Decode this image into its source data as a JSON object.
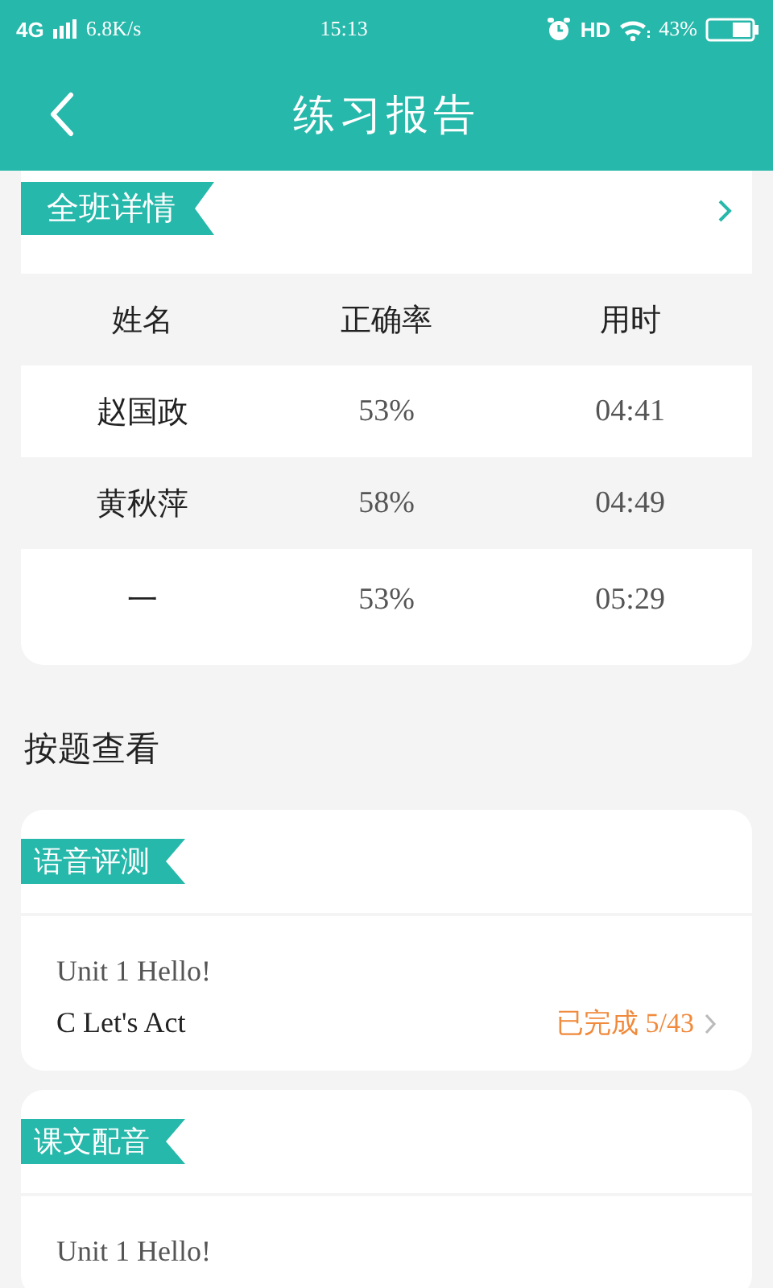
{
  "status_bar": {
    "network": "4G",
    "speed": "6.8K/s",
    "time": "15:13",
    "hd": "HD",
    "battery": "43%"
  },
  "header": {
    "title": "练习报告"
  },
  "class_details": {
    "label": "全班详情",
    "columns": [
      "姓名",
      "正确率",
      "用时"
    ],
    "rows": [
      [
        "赵国政",
        "53%",
        "04:41"
      ],
      [
        "黄秋萍",
        "58%",
        "04:49"
      ],
      [
        "一",
        "53%",
        "05:29"
      ]
    ]
  },
  "section_title": "按题查看",
  "sections": [
    {
      "label": "语音评测",
      "unit": "Unit 1 Hello!",
      "lesson": "C Let's Act",
      "progress": "已完成 5/43"
    },
    {
      "label": "课文配音",
      "unit": "Unit 1 Hello!"
    }
  ]
}
